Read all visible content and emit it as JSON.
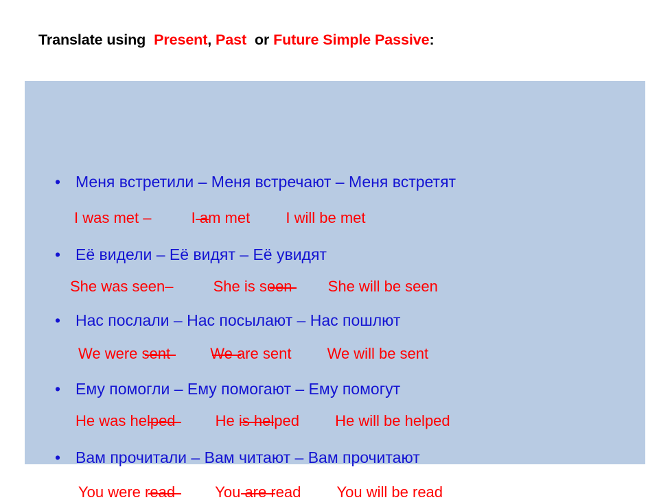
{
  "slide": {
    "background_color": "#ffffff",
    "panel_color": "#b8cbe3",
    "blue_text_color": "#1414d2",
    "red_text_color": "#ff0000"
  },
  "title": {
    "part1": "Translate using",
    "part2": "Present",
    "part3": ",",
    "part4": "Past",
    "part5": "or",
    "part6": "Future Simple Passive",
    "part7": ":"
  },
  "rows": [
    {
      "bullet": "•",
      "russian": "Меня встретили – Меня встречают – Меня встретят",
      "past": "I  was  met",
      "dash": "–",
      "present": "I  am  met",
      "future": "I  will  be  met"
    },
    {
      "bullet": "•",
      "russian": "Её видели   –   Её видят  –   Её увидят",
      "past": "She was seen",
      "dash": "–",
      "present": "She is seen",
      "future": "She will be seen"
    },
    {
      "bullet": "•",
      "russian": "Нас послали – Нас посылают – Нас пошлют",
      "past": "We were sent",
      "dash": "",
      "present": "We are sent",
      "future": "We will be sent"
    },
    {
      "bullet": "•",
      "russian": "Ему помогли – Ему помогают – Ему помогут",
      "past": "He was helped",
      "dash": "",
      "present": "He is helped",
      "future": "He will be helped"
    },
    {
      "bullet": "•",
      "russian": "Вам прочитали – Вам читают – Вам прочитают",
      "past": "You were read",
      "dash": "",
      "present": "You are read",
      "future": "You will be read"
    }
  ]
}
